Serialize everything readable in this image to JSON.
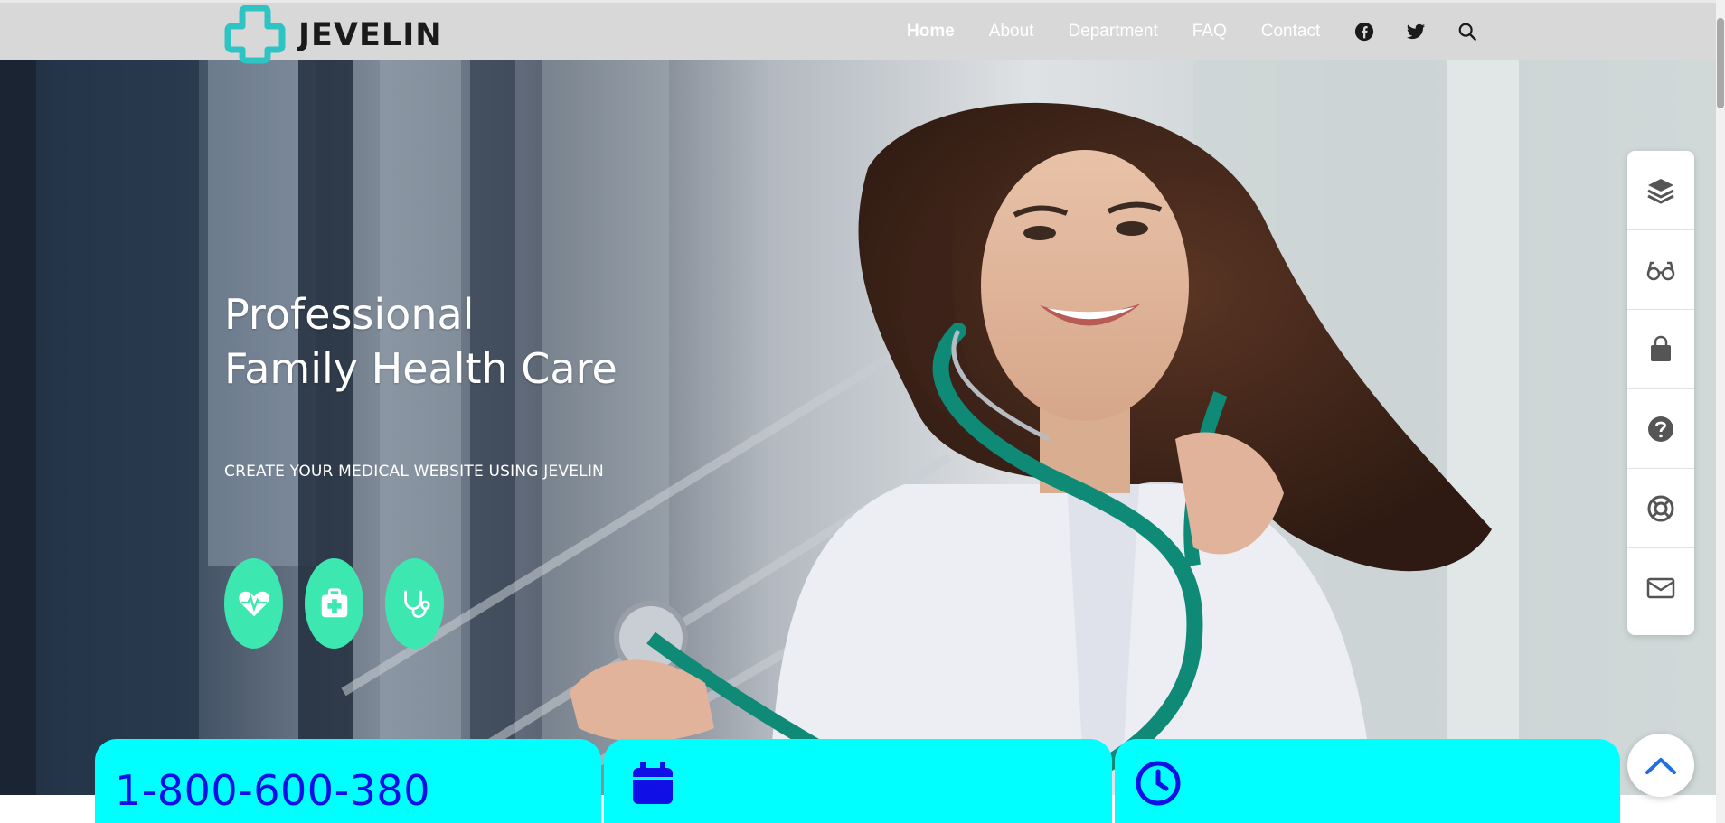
{
  "header": {
    "logo_text": "JEVELIN",
    "nav": [
      {
        "label": "Home",
        "active": true
      },
      {
        "label": "About"
      },
      {
        "label": "Department"
      },
      {
        "label": "FAQ"
      },
      {
        "label": "Contact"
      }
    ],
    "icons": [
      "facebook-icon",
      "twitter-icon",
      "search-icon"
    ]
  },
  "hero": {
    "title_line1": "Professional",
    "title_line2": "Family Health Care",
    "subtitle": "CREATE YOUR MEDICAL WEBSITE USING JEVELIN",
    "feature_icons": [
      "heartbeat-icon",
      "first-aid-kit-icon",
      "stethoscope-icon"
    ]
  },
  "side_toolbar": {
    "items": [
      "layers-icon",
      "glasses-icon",
      "shopping-bag-icon",
      "question-circle-icon",
      "lifebuoy-icon",
      "envelope-icon"
    ]
  },
  "info_cards": {
    "phone": "1-800-600-380",
    "card2_icon": "calendar-icon",
    "card3_icon": "clock-icon"
  },
  "colors": {
    "accent": "#3ce8b0",
    "logo_teal": "#2ec4c4",
    "card_bg": "#00ffff",
    "card_text": "#1010e6",
    "header_bg": "#d8d8d8"
  }
}
